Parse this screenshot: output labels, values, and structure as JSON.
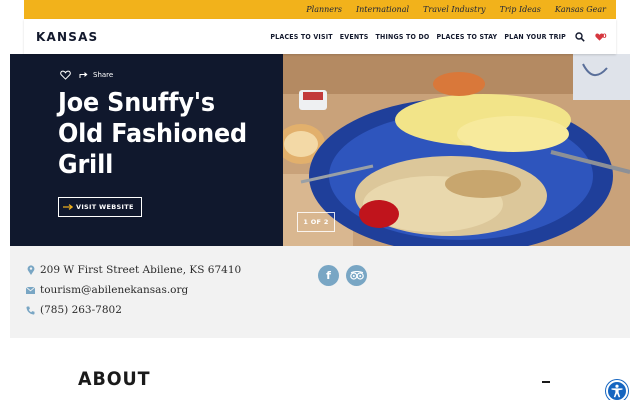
{
  "utility_nav": {
    "links": [
      "Planners",
      "International",
      "Travel Industry",
      "Trip Ideas",
      "Kansas Gear"
    ]
  },
  "main_nav": {
    "logo": "KANSAS",
    "links": [
      "PLACES TO VISIT",
      "EVENTS",
      "THINGS TO DO",
      "PLACES TO STAY",
      "PLAN YOUR TRIP"
    ],
    "favorites_count": "0"
  },
  "hero": {
    "share_label": "Share",
    "title": "Joe Snuffy's Old Fashioned Grill",
    "visit_label": "VISIT WEBSITE",
    "slide_counter": "1 OF 2"
  },
  "contact": {
    "address": "209 W First Street Abilene, KS 67410",
    "email": "tourism@abilenekansas.org",
    "phone": "(785) 263-7802"
  },
  "social": {
    "facebook_glyph": "f",
    "tripadvisor_glyph": "tripadvisor-icon"
  },
  "about": {
    "heading": "ABOUT"
  },
  "colors": {
    "utility_bar": "#f2b21b",
    "navy": "#10182d",
    "accent_blue": "#79a6c4",
    "heart_red": "#d6373f",
    "info_band": "#f2f2f2"
  }
}
